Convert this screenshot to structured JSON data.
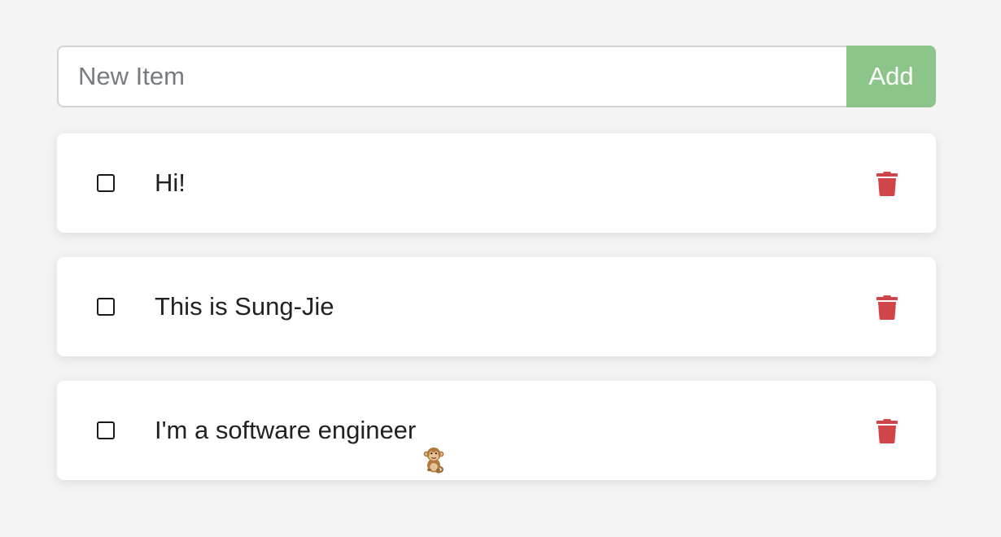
{
  "new_item": {
    "placeholder": "New Item",
    "value": "",
    "add_label": "Add"
  },
  "todos": [
    {
      "text": "Hi!",
      "checked": false,
      "emoji": ""
    },
    {
      "text": "This is Sung-Jie",
      "checked": false,
      "emoji": ""
    },
    {
      "text": "I'm a software engineer",
      "checked": false,
      "emoji": "monkey-icon"
    }
  ],
  "colors": {
    "background": "#f4f4f4",
    "add_button": "#8cc58a",
    "delete_icon": "#d0454a",
    "text": "#222222",
    "placeholder": "#777c82"
  },
  "icons": {
    "delete": "trash-icon",
    "checkbox": "checkbox-icon"
  }
}
